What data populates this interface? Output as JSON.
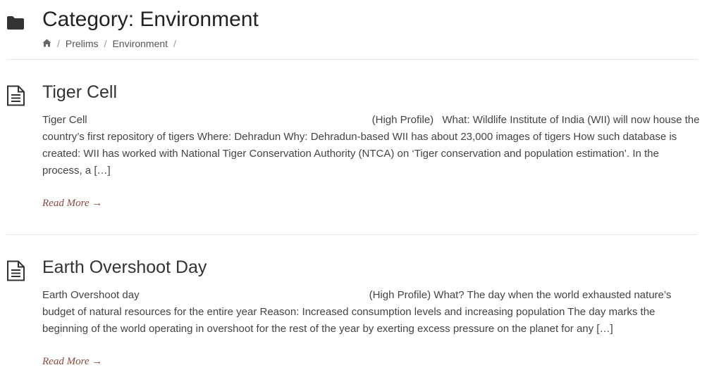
{
  "category": {
    "title": "Category: Environment",
    "icon": "folder-icon"
  },
  "breadcrumb": {
    "home_icon": "home-icon",
    "separator": "/",
    "items": [
      "Prelims",
      "Environment"
    ]
  },
  "posts": [
    {
      "icon": "document-icon",
      "title": "Tiger Cell",
      "excerpt": {
        "lead": "Tiger Cell",
        "profile": "(High Profile)",
        "body": "What: Wildlife Institute of India (WII) will now house the country’s first repository of tigers Where: Dehradun Why: Dehradun-based WII has about 23,000 images of tigers How such database is created: WII has worked with National Tiger Conservation Authority (NTCA) on ‘Tiger conservation and population estimation’. In the process, a […]"
      },
      "read_more": "Read More →"
    },
    {
      "icon": "document-icon",
      "title": "Earth Overshoot Day",
      "excerpt": {
        "lead": "Earth Overshoot day",
        "profile": "(High Profile)",
        "body": "What? The day when the world exhausted nature’s budget of natural resources for the entire year Reason: Increased consumption levels and increasing population The day marks the beginning of the world operating in overshoot for the rest of the year by exerting excess pressure on the planet for any […]"
      },
      "read_more": "Read More →"
    }
  ],
  "colors": {
    "title": "#222222",
    "text": "#444444",
    "link": "#8a4a3b",
    "divider": "#e6e6e6",
    "icon": "#333333"
  }
}
